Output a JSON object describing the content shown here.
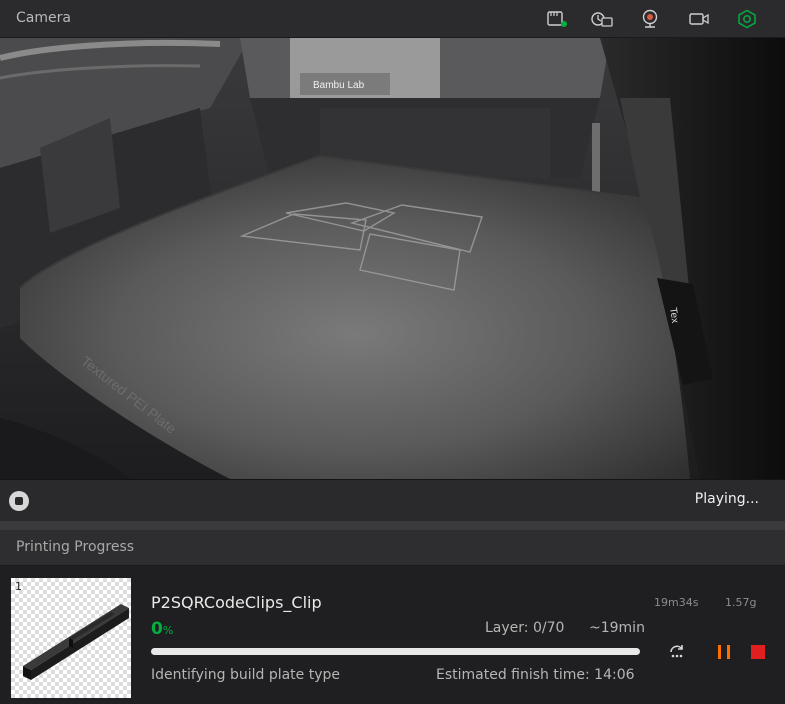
{
  "camera": {
    "title": "Camera",
    "header_icons": [
      "sd-card-icon",
      "timelapse-icon",
      "webcam-icon",
      "video-record-icon",
      "hex-settings-icon"
    ],
    "status": "Playing...",
    "stop_icon": "stop-icon",
    "scene": {
      "printer_brand": "Bambu Lab",
      "plate_text": "Textured PEI Plate",
      "clip_brand": "Tex"
    }
  },
  "progress": {
    "title": "Printing Progress",
    "plate_number": "1",
    "job_name": "P2SQRCodeClips_Clip",
    "duration": "19m34s",
    "weight": "1.57g",
    "percent_value": "0",
    "percent_unit": "%",
    "progress_fraction": 0.0,
    "layer": "Layer: 0/70",
    "remaining": "~19min",
    "stage": "Identifying build plate type",
    "finish_time": "Estimated finish time: 14:06",
    "controls": [
      "skip-objects-icon",
      "pause-icon",
      "stop-icon"
    ]
  },
  "colors": {
    "accent_green": "#00ae42",
    "pause_orange": "#ff6f00",
    "stop_red": "#e02020"
  }
}
